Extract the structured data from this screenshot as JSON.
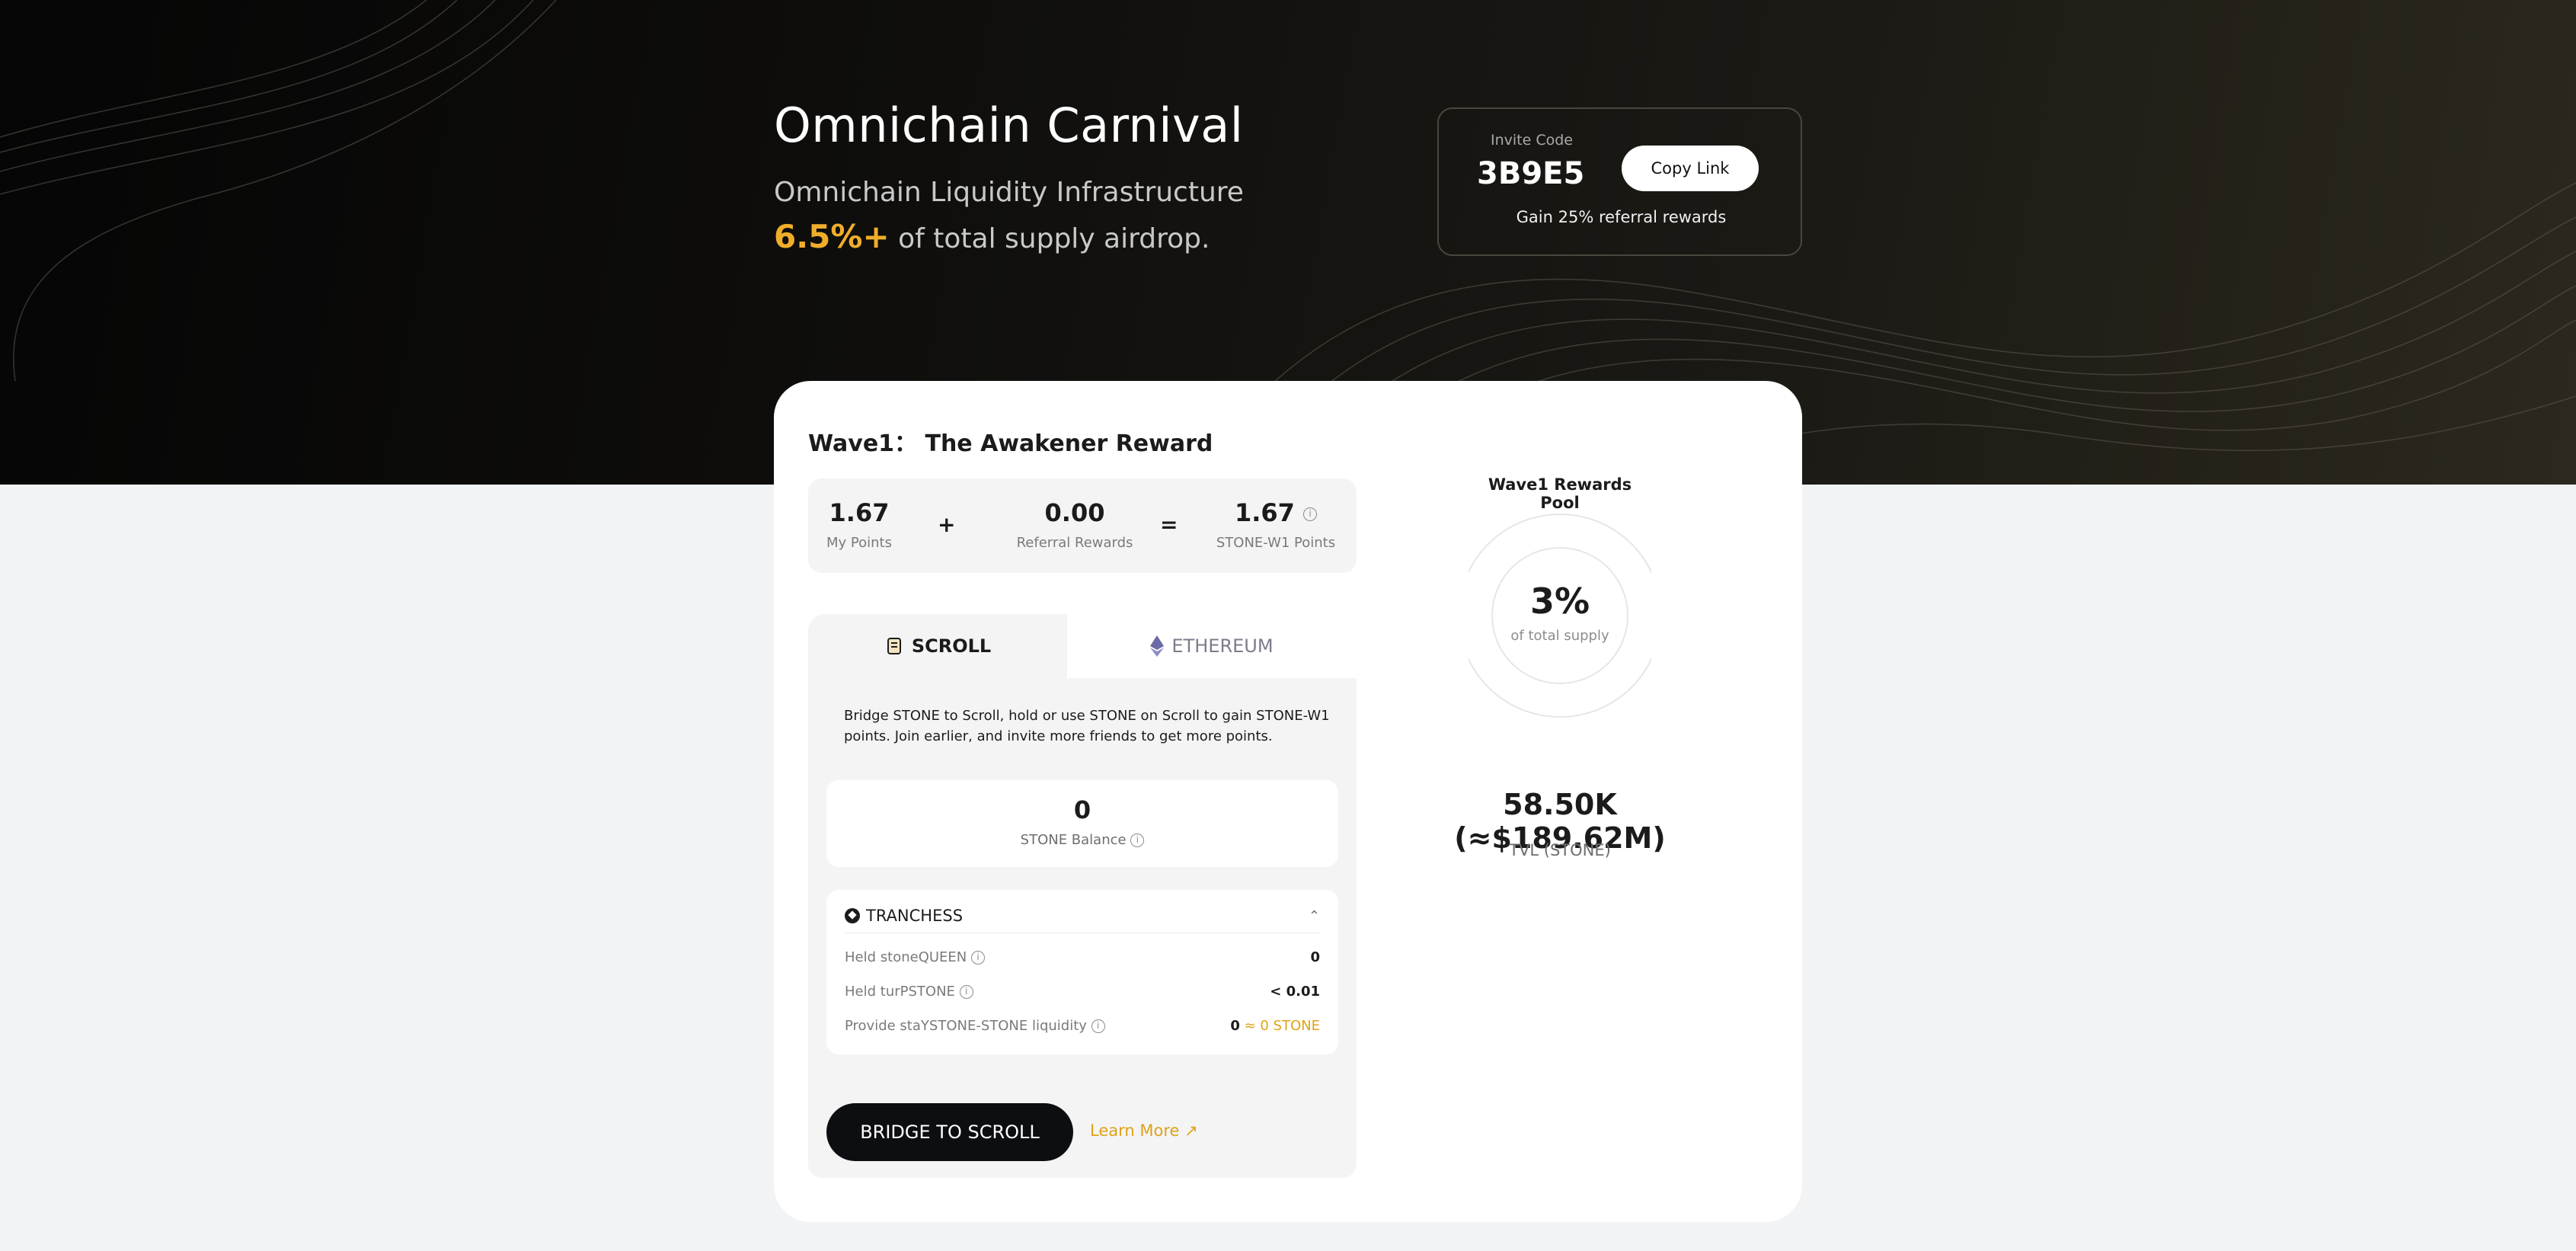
{
  "hero": {
    "title": "Omnichain Carnival",
    "subtitle": "Omnichain Liquidity Infrastructure",
    "airdrop_accent": "6.5%+",
    "airdrop_text": " of total supply airdrop."
  },
  "invite": {
    "label": "Invite Code",
    "code": "3B9E5",
    "copy_button": "Copy Link",
    "note": "Gain 25% referral rewards"
  },
  "wave": {
    "title": "Wave1： The Awakener Reward",
    "my_points": {
      "value": "1.67",
      "label": "My Points"
    },
    "plus": "+",
    "referral": {
      "value": "0.00",
      "label": "Referral Rewards"
    },
    "equals": "=",
    "total": {
      "value": "1.67",
      "label": "STONE-W1 Points"
    }
  },
  "tabs": [
    {
      "label": "SCROLL",
      "icon": "scroll-icon",
      "active": true
    },
    {
      "label": "ETHEREUM",
      "icon": "ethereum-icon",
      "active": false
    }
  ],
  "scroll_panel": {
    "description": "Bridge STONE to Scroll, hold or use STONE on Scroll to gain STONE-W1 points. Join earlier, and invite more friends to get more points.",
    "balance_value": "0",
    "balance_label": "STONE Balance",
    "tranchess": {
      "title": "TRANCHESS",
      "rows": [
        {
          "label": "Held stoneQUEEN",
          "value": "0",
          "extra": ""
        },
        {
          "label": "Held turPSTONE",
          "value": "< 0.01",
          "extra": ""
        },
        {
          "label": "Provide staYSTONE-STONE liquidity",
          "value": "0",
          "extra": " ≈ 0 STONE"
        }
      ]
    },
    "bridge_button": "BRIDGE TO SCROLL",
    "learn_more": "Learn More"
  },
  "pool": {
    "title": "Wave1 Rewards Pool",
    "percent": "3%",
    "percent_label": "of total supply",
    "tvl_value": "58.50K  (≈$189.62M)",
    "tvl_label": "TVL (STONE)"
  },
  "colors": {
    "accent_gold": "#f0ad2b",
    "dark_button": "#0d0e12",
    "panel_bg": "#f4f4f5"
  }
}
